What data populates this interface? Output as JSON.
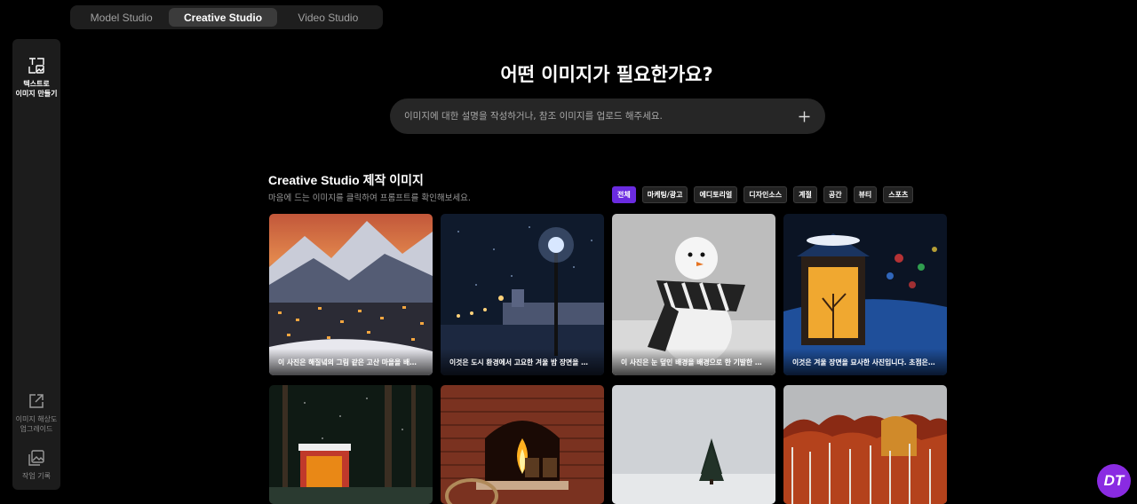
{
  "top_tabs": [
    {
      "label": "Model Studio",
      "active": false
    },
    {
      "label": "Creative Studio",
      "active": true
    },
    {
      "label": "Video Studio",
      "active": false
    }
  ],
  "sidebar": {
    "items": [
      {
        "label_line1": "텍스트로",
        "label_line2": "이미지 만들기",
        "icon": "text-to-image-icon",
        "active": true
      },
      {
        "label_line1": "이미지 해상도",
        "label_line2": "업그레이드",
        "icon": "external-link-icon",
        "active": false
      },
      {
        "label_line1": "작업 기록",
        "label_line2": "",
        "icon": "image-stack-icon",
        "active": false
      }
    ]
  },
  "hero": {
    "title": "어떤 이미지가 필요한가요?",
    "placeholder": "이미지에 대한 설명을 작성하거나, 참조 이미지를 업로드 해주세요."
  },
  "gallery": {
    "title": "Creative Studio 제작 이미지",
    "subtitle": "마음에 드는 이미지를 클릭하여 프롬프트를 확인해보세요.",
    "filters": [
      {
        "label": "전체",
        "active": true
      },
      {
        "label": "마케팅/광고",
        "active": false
      },
      {
        "label": "에디토리얼",
        "active": false
      },
      {
        "label": "디자인소스",
        "active": false
      },
      {
        "label": "계절",
        "active": false
      },
      {
        "label": "공간",
        "active": false
      },
      {
        "label": "뷰티",
        "active": false
      },
      {
        "label": "스포츠",
        "active": false
      }
    ],
    "cards": [
      {
        "caption": "이 사진은 해질녘의 그림 같은 고산 마을을 배…"
      },
      {
        "caption": "이것은 도시 환경에서 고요한 겨울 밤 장면을 …"
      },
      {
        "caption": "이 사진은 눈 덮인 배경을 배경으로 한 기발한 …"
      },
      {
        "caption": "이것은 겨울 장면을 묘사한 사진입니다. 초점은…"
      },
      {
        "caption": ""
      },
      {
        "caption": ""
      },
      {
        "caption": ""
      },
      {
        "caption": ""
      }
    ]
  },
  "badge": {
    "label": "DT"
  },
  "colors": {
    "accent": "#6a2be0",
    "badge": "#8a2be2",
    "background": "#000000"
  }
}
